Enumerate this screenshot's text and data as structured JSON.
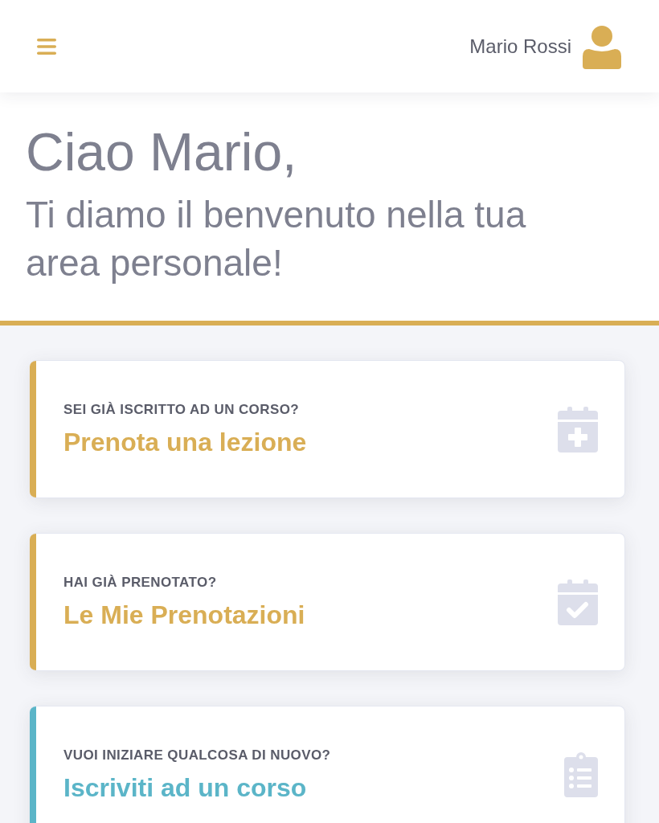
{
  "header": {
    "user_name": "Mario Rossi"
  },
  "greeting": {
    "title": "Ciao Mario,",
    "subtitle": "Ti diamo il benvenuto nella tua area personale!"
  },
  "cards": [
    {
      "kind": "plus",
      "color": "#d9ae55",
      "label": "SEI GIÀ ISCRITTO AD UN CORSO?",
      "title": "Prenota una lezione"
    },
    {
      "kind": "check",
      "color": "#d9ae55",
      "label": "HAI GIÀ PRENOTATO?",
      "title": "Le Mie Prenotazioni"
    },
    {
      "kind": "list",
      "color": "#5bb5c8",
      "label": "VUOI INIZIARE QUALCOSA DI NUOVO?",
      "title": "Iscriviti ad un corso"
    }
  ]
}
